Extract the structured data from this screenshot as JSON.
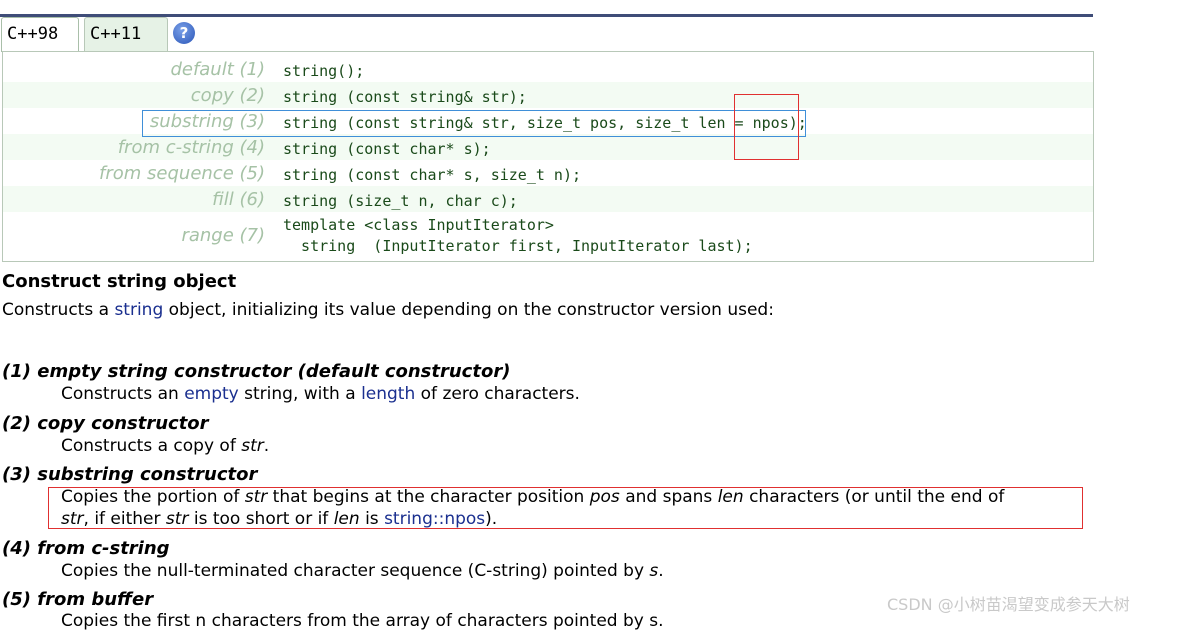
{
  "tabs": [
    {
      "label": "C++98",
      "active": true
    },
    {
      "label": "C++11",
      "active": false
    }
  ],
  "help_icon": "question-circle-icon",
  "help_glyph": "?",
  "prototypes": [
    {
      "label": "default (1)",
      "code": "string();"
    },
    {
      "label": "copy (2)",
      "code": "string (const string& str);"
    },
    {
      "label": "substring (3)",
      "code": "string (const string& str, size_t pos, size_t len = npos);"
    },
    {
      "label": "from c-string (4)",
      "code": "string (const char* s);"
    },
    {
      "label": "from sequence (5)",
      "code": "string (const char* s, size_t n);"
    },
    {
      "label": "fill (6)",
      "code": "string (size_t n, char c);"
    },
    {
      "label": "range (7)",
      "code_line1": "template <class InputIterator>",
      "code_line2": "  string  (InputIterator first, InputIterator last);"
    }
  ],
  "section_title": "Construct string object",
  "intro": {
    "before": "Constructs a ",
    "link": "string",
    "after": " object, initializing its value depending on the constructor version used:"
  },
  "definitions": {
    "d1_title": "(1) empty string constructor (default constructor)",
    "d1_a": "Constructs an ",
    "d1_link1": "empty",
    "d1_b": " string, with a ",
    "d1_link2": "length",
    "d1_c": " of zero characters.",
    "d2_title": "(2) copy constructor",
    "d2_a": "Constructs a copy of ",
    "d2_em": "str",
    "d2_b": ".",
    "d3_title": "(3) substring constructor",
    "d3_l1_a": "Copies the portion of ",
    "d3_l1_str": "str",
    "d3_l1_b": " that begins at the character position ",
    "d3_l1_pos": "pos",
    "d3_l1_c": " and spans ",
    "d3_l1_len": "len",
    "d3_l1_d": " characters (or until the end of",
    "d3_l2_str": "str",
    "d3_l2_a": ", if either ",
    "d3_l2_str2": "str",
    "d3_l2_b": " is too short or if ",
    "d3_l2_len": "len",
    "d3_l2_c": " is ",
    "d3_l2_link": "string::npos",
    "d3_l2_d": ").",
    "d4_title": "(4) from c-string",
    "d4_a": "Copies the null-terminated character sequence (C-string) pointed by ",
    "d4_em": "s",
    "d4_b": ".",
    "d5_title": "(5) from buffer",
    "d5_partial": "Copies the first n characters from the array of characters pointed by s."
  },
  "watermark": "CSDN @小树苗渴望变成参天大树"
}
